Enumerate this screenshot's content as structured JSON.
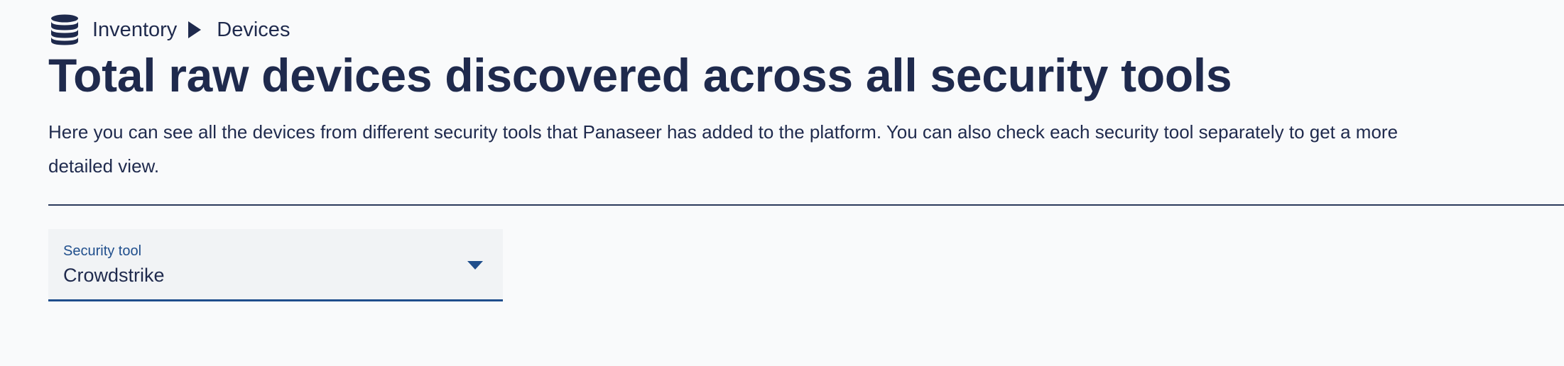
{
  "breadcrumb": {
    "icon": "database-icon",
    "items": [
      "Inventory",
      "Devices"
    ],
    "separator_icon": "triangle-right-icon"
  },
  "page": {
    "title": "Total raw devices discovered across all security tools",
    "description": "Here you can see all the devices from different security tools that Panaseer has added to the platform. You can also check each security tool separately to get a more detailed view."
  },
  "filter": {
    "label": "Security tool",
    "selected": "Crowdstrike",
    "icon": "chevron-down-icon"
  },
  "colors": {
    "text": "#1f2a4d",
    "accent": "#1f4e8c",
    "background": "#f9fafb",
    "field_background": "#f1f3f5"
  }
}
